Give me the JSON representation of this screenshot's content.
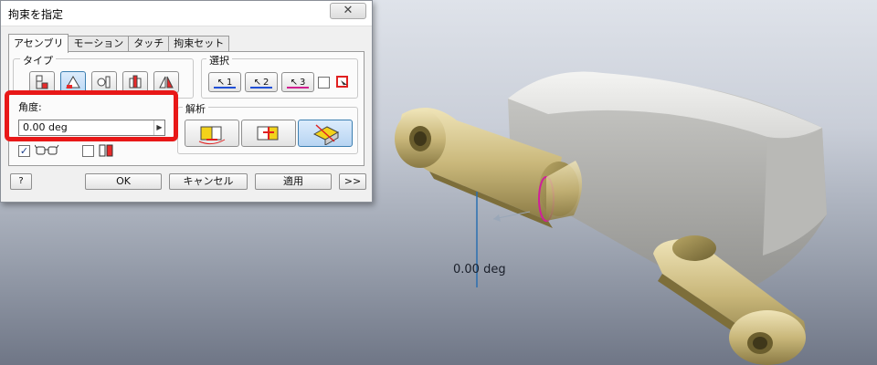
{
  "dialog": {
    "title": "拘束を指定",
    "close_glyph": "✕",
    "tabs": [
      {
        "label": "アセンブリ",
        "active": true
      },
      {
        "label": "モーション",
        "active": false
      },
      {
        "label": "タッチ",
        "active": false
      },
      {
        "label": "拘束セット",
        "active": false
      }
    ],
    "type_group_label": "タイプ",
    "type_buttons": [
      {
        "icon": "mate-constraint-icon",
        "selected": false
      },
      {
        "icon": "angle-constraint-icon",
        "selected": true
      },
      {
        "icon": "tangent-constraint-icon",
        "selected": false
      },
      {
        "icon": "insert-constraint-icon",
        "selected": false
      },
      {
        "icon": "symmetry-constraint-icon",
        "selected": false
      }
    ],
    "selection_group_label": "選択",
    "selection_buttons": [
      {
        "num": "1",
        "color": "#1f4fd6"
      },
      {
        "num": "2",
        "color": "#1f4fd6"
      },
      {
        "num": "3",
        "color": "#d02090"
      }
    ],
    "angle_label": "角度:",
    "angle_value": "0.00 deg",
    "solution_group_label": "解析",
    "solution_buttons": [
      {
        "icon": "directed-angle-icon",
        "selected": false
      },
      {
        "icon": "undirected-angle-icon",
        "selected": false
      },
      {
        "icon": "explicit-reference-vector-icon",
        "selected": true
      }
    ],
    "show_preview_checked": true,
    "predict_offset_checked": false,
    "ok_label": "OK",
    "cancel_label": "キャンセル",
    "apply_label": "適用",
    "more_label": ">>",
    "help_glyph": "?"
  },
  "viewport": {
    "angle_readout": "0.00 deg",
    "accent_color": "#e81818"
  }
}
